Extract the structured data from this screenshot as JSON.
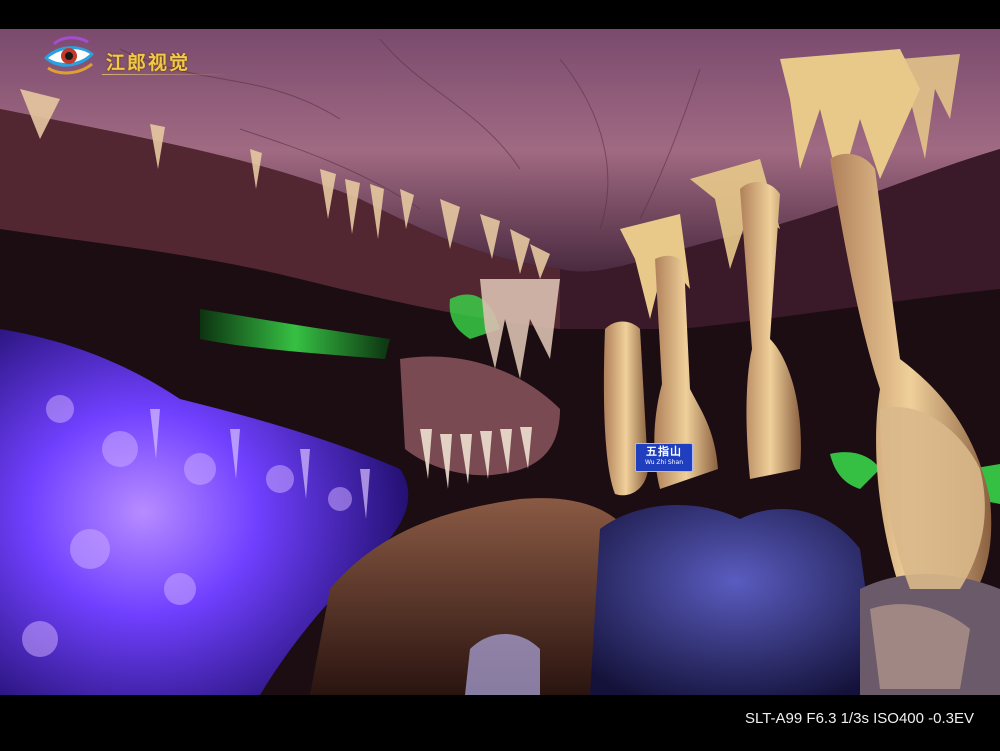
{
  "watermark": {
    "text": "江郎视觉",
    "icon": "eye-logo-icon"
  },
  "sign": {
    "title": "五指山",
    "subtitle": "Wu Zhi Shan"
  },
  "exif": {
    "text": "SLT-A99 F6.3 1/3s ISO400 -0.3EV"
  },
  "colors": {
    "background": "#000000",
    "ceiling": "#8a5a78",
    "purple_light": "#6a3cff",
    "green_light": "#39e04a",
    "stalactite": "#e8c98a",
    "sign": "#1f3fbf",
    "watermark": "#f2c84a"
  }
}
